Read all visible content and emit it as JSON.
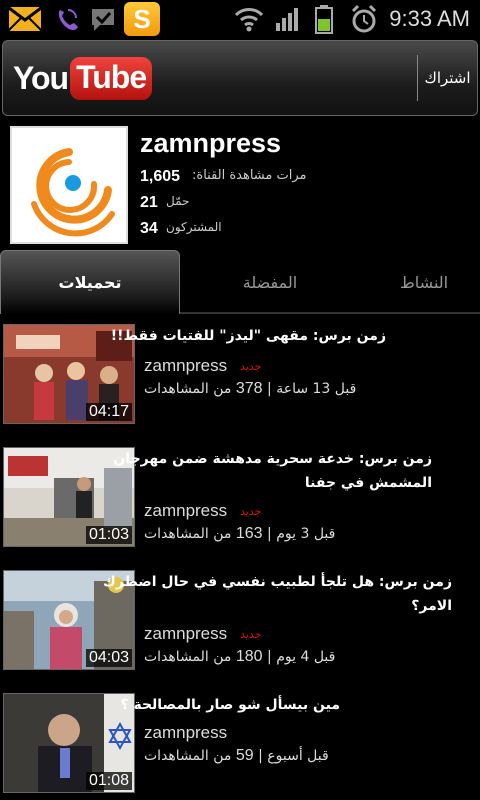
{
  "status_bar": {
    "time": "9:33 AM",
    "icons": [
      "mail-icon",
      "viber-icon",
      "checkmark-speech-icon",
      "app-s-icon",
      "wifi-icon",
      "signal-icon",
      "battery-icon",
      "alarm-icon"
    ],
    "app_s_label": "S"
  },
  "header": {
    "logo_you": "You",
    "logo_tube": "Tube",
    "subscribe_label": "اشتراك"
  },
  "channel": {
    "name": "zamnpress",
    "views_value": "1,605",
    "views_label": "مرات مشاهدة القناة:",
    "uploads_value": "21",
    "uploads_label": "حمّل",
    "subscribers_value": "34",
    "subscribers_label": "المشتركون"
  },
  "tabs": [
    {
      "label": "تحميلات",
      "active": true
    },
    {
      "label": "المفضلة",
      "active": false
    },
    {
      "label": "النشاط",
      "active": false
    }
  ],
  "videos": [
    {
      "title_prefix": "زمن برس",
      "title": "مقهى \"ليدز\" للفتيات فقط!!",
      "channel": "zamnpress",
      "badge": "جديد",
      "time_ago": "قبل 13 ساعة",
      "views": "378",
      "views_label": "من المشاهدات",
      "duration": "04:17"
    },
    {
      "title_prefix": "زمن برس",
      "title": "خدعة سحرية مدهشة ضمن مهرجان المشمش في جفنا",
      "channel": "zamnpress",
      "badge": "جديد",
      "time_ago": "قبل 3 يوم",
      "views": "163",
      "views_label": "من المشاهدات",
      "duration": "01:03"
    },
    {
      "title_prefix": "زمن برس",
      "title": "هل تلجأ لطبيب نفسي في حال اضطرك الامر؟",
      "channel": "zamnpress",
      "badge": "جديد",
      "time_ago": "قبل 4 يوم",
      "views": "180",
      "views_label": "من المشاهدات",
      "duration": "04:03"
    },
    {
      "title_prefix": "",
      "title": "مين بيسأل شو صار بالمصالحة ؟",
      "channel": "zamnpress",
      "badge": "",
      "time_ago": "قبل أسبوع",
      "views": "59",
      "views_label": "من المشاهدات",
      "duration": "01:08"
    }
  ],
  "colors": {
    "badge_red": "#dd1111",
    "youtube_red": "#d9231f",
    "avatar_orange": "#f08a1d",
    "avatar_blue": "#1a9ae0"
  }
}
